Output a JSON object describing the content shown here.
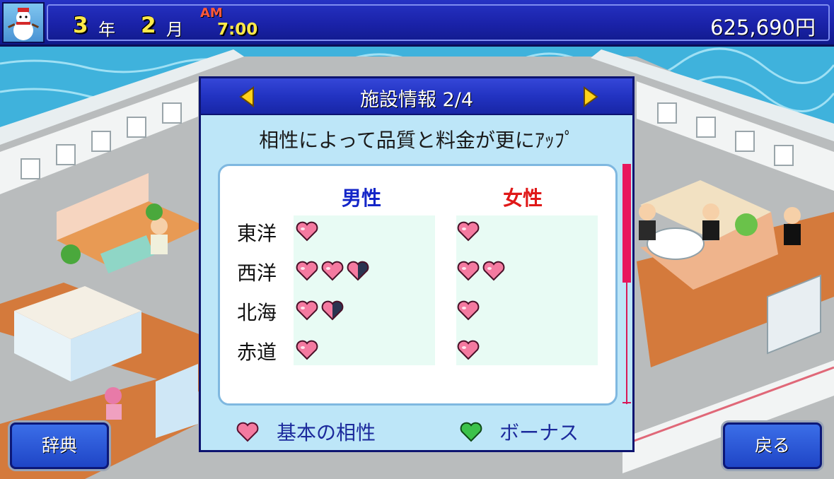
{
  "status_bar": {
    "year_value": "3",
    "year_unit": "年",
    "month_value": "2",
    "month_unit": "月",
    "ampm": "AM",
    "time": "7:00",
    "money": "625,690円"
  },
  "dialog": {
    "title": "施設情報 2/4",
    "subtitle": "相性によって品質と料金が更にｱｯﾌﾟ",
    "columns": {
      "male": "男性",
      "female": "女性"
    },
    "rows": [
      {
        "label": "東洋",
        "male_hearts": 1,
        "female_hearts": 1
      },
      {
        "label": "西洋",
        "male_hearts": 2.5,
        "female_hearts": 2
      },
      {
        "label": "北海",
        "male_hearts": 1.5,
        "female_hearts": 1
      },
      {
        "label": "赤道",
        "male_hearts": 1,
        "female_hearts": 1
      }
    ],
    "legend": {
      "base_label": "基本の相性",
      "bonus_label": "ボーナス"
    },
    "scroll_position": 0.35
  },
  "buttons": {
    "dictionary": "辞典",
    "back": "戻る"
  },
  "colors": {
    "male": "#1426c8",
    "female": "#e01818",
    "heart_base": "#f47aa0",
    "heart_bonus": "#3cc24a",
    "heart_empty": "#2a3350",
    "scroll_thumb": "#e8175d"
  }
}
